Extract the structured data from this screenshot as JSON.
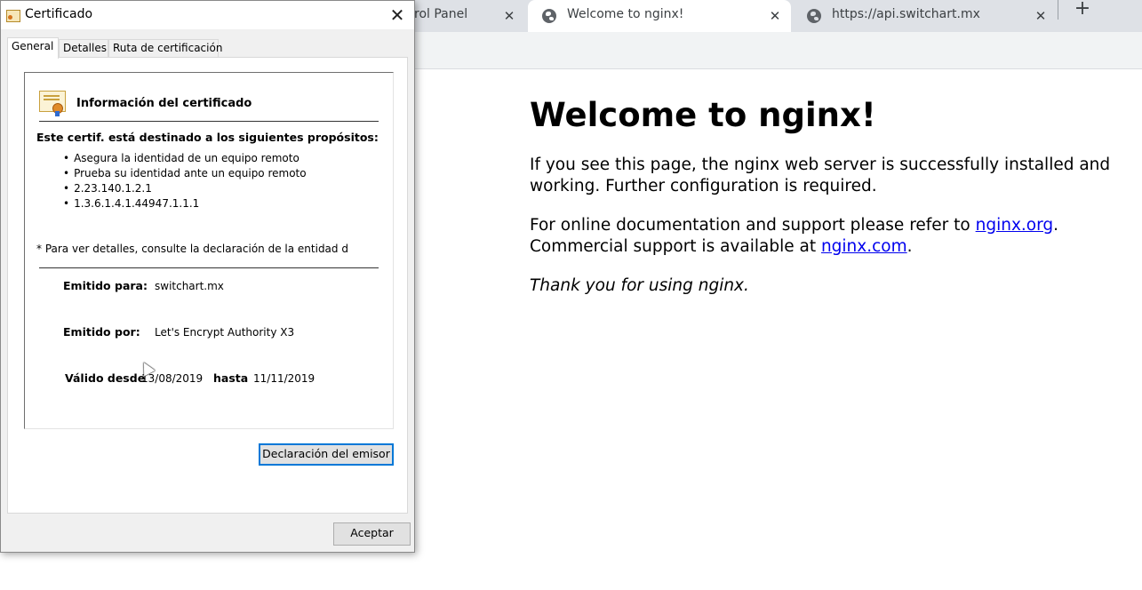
{
  "browser": {
    "tabs": [
      {
        "title": "rol Panel",
        "active": false
      },
      {
        "title": "Welcome to nginx!",
        "active": true
      },
      {
        "title": "https://api.switchart.mx",
        "active": false
      }
    ],
    "close_glyph": "✕",
    "new_tab_glyph": "+"
  },
  "page": {
    "heading": "Welcome to nginx!",
    "para1": "If you see this page, the nginx web server is successfully installed and working. Further configuration is required.",
    "para2_prefix": "For online documentation and support please refer to ",
    "link1": "nginx.org",
    "para2_middle": ". Commercial support is available at ",
    "link2": "nginx.com",
    "para2_suffix": ".",
    "thanks": "Thank you for using nginx."
  },
  "dialog": {
    "title": "Certificado",
    "close_glyph": "✕",
    "tabs": [
      "General",
      "Detalles",
      "Ruta de certificación"
    ],
    "active_tab": "General",
    "info_heading": "Información del certificado",
    "purposes_heading": "Este certif. está destinado a los siguientes propósitos:",
    "purposes": [
      "Asegura la identidad de un equipo remoto",
      "Prueba su identidad ante un equipo remoto",
      "2.23.140.1.2.1",
      "1.3.6.1.4.1.44947.1.1.1"
    ],
    "note": "* Para ver detalles, consulte la declaración de la entidad de c",
    "issued_to_label": "Emitido para:",
    "issued_to": "switchart.mx",
    "issued_by_label": "Emitido por:",
    "issued_by": "Let's Encrypt Authority X3",
    "valid_from_label": "Válido desde",
    "valid_from": "13/08/2019",
    "valid_to_label": "hasta",
    "valid_to": "11/11/2019",
    "issuer_statement_button": "Declaración del emisor",
    "ok_button": "Aceptar"
  },
  "colors": {
    "link": "#0000ee",
    "focus_border": "#0078d7",
    "tabbar_bg": "#dee1e6"
  }
}
